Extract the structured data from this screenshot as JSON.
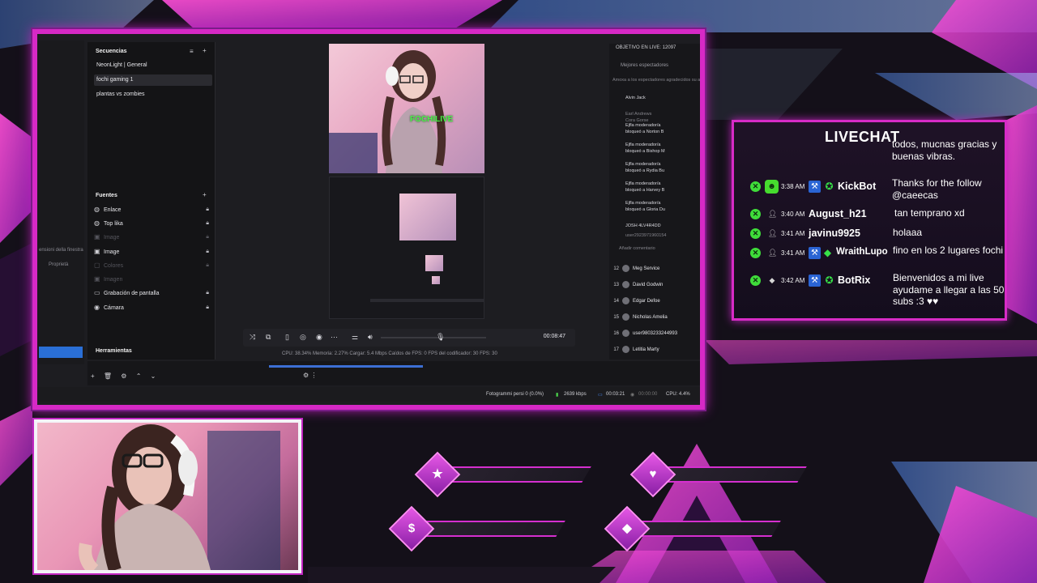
{
  "editor": {
    "left_strip": {
      "text1": "ensioni della finestra",
      "text2": "Proprietà"
    },
    "sequences": {
      "title": "Secuencias",
      "items": [
        "NeonLight | General",
        "fochi gaming 1",
        "plantas vs zombies"
      ]
    },
    "sources": {
      "title": "Fuentes",
      "items": [
        {
          "label": "Enlace",
          "dim": false
        },
        {
          "label": "Top lika",
          "dim": false
        },
        {
          "label": "Image",
          "dim": true
        },
        {
          "label": "Image",
          "dim": false
        },
        {
          "label": "Colores",
          "dim": true
        },
        {
          "label": "Imagen",
          "dim": true
        },
        {
          "label": "Grabación de pantalla",
          "dim": false
        },
        {
          "label": "Cámara",
          "dim": false
        }
      ]
    },
    "tools_label": "Herramientas",
    "preview_text": "FOCHILIVE",
    "playback_time": "00:08:47",
    "stats": "CPU: 38.34%   Memoria: 2.27%   Cargar: 5.4 Mbps   Caídos de FPS: 0   FPS del codificador: 30   FPS: 30",
    "status_bar": {
      "frames": "Fotogrammi persi 0 (0.0%)",
      "kbps": "2639 kbps",
      "rec_time": "00:03:21",
      "stream_time": "00:00:00",
      "cpu": "CPU: 4.4%"
    },
    "mini_chat": {
      "title": "OBJETIVO EN LIVE: 12097",
      "subtitle": "Mejores espectadores",
      "greeting": "Amoxa a los espectadores agradecidos su ap",
      "users_top": [
        "Alvin Jack",
        "Earl Andrews",
        "Cora Gorse"
      ],
      "mod_lines": [
        "Ejfla moderador/a",
        "bloqueó a Norton B",
        "Ejfla moderador/a",
        "bloqueó a Bishop M",
        "Ejfla moderador/a",
        "bloqueó a Rydia Bu",
        "Ejfla moderador/a",
        "bloqueó a Harvey B",
        "Ejfla moderador/a",
        "bloqueó a Gloria Du"
      ],
      "extra_lines": [
        "JOSH 4LV4R4DD",
        "user2923971960154",
        "Añadir comentario"
      ],
      "ranks": [
        {
          "n": "12",
          "name": "Meg Service"
        },
        {
          "n": "13",
          "name": "David Godwin"
        },
        {
          "n": "14",
          "name": "Edgar Defoe"
        },
        {
          "n": "15",
          "name": "Nicholas Amelia"
        },
        {
          "n": "16",
          "name": "user9803233244993"
        },
        {
          "n": "17",
          "name": "Letitia Marty"
        }
      ]
    }
  },
  "livechat": {
    "title": "LIVECHAT",
    "top_message": "todos, mucnas gracias y buenas vibras.",
    "messages": [
      {
        "time": "3:38 AM",
        "user": "KickBot",
        "text": "Thanks for the follow @caeecas"
      },
      {
        "time": "3:40 AM",
        "user": "August_h21",
        "text": "tan temprano xd"
      },
      {
        "time": "3:41 AM",
        "user": "javinu9925",
        "text": "holaaa"
      },
      {
        "time": "3:41 AM",
        "user": "WraithLupo",
        "text": "fino en los 2 lugares fochi"
      },
      {
        "time": "3:42 AM",
        "user": "BotRix",
        "text": "Bienvenidos a mi live ayudame a llegar a las 50 subs :3 ♥♥"
      }
    ]
  },
  "stat_slots": [
    {
      "icon": "star-icon",
      "glyph": "★",
      "value": ""
    },
    {
      "icon": "heart-icon",
      "glyph": "♥",
      "value": ""
    },
    {
      "icon": "dollar-icon",
      "glyph": "$",
      "value": ""
    },
    {
      "icon": "diamond-icon",
      "glyph": "◆",
      "value": ""
    }
  ],
  "colors": {
    "accent": "#d629c6",
    "kick_green": "#3fdc3a",
    "obs_blue": "#2a6fd6"
  }
}
